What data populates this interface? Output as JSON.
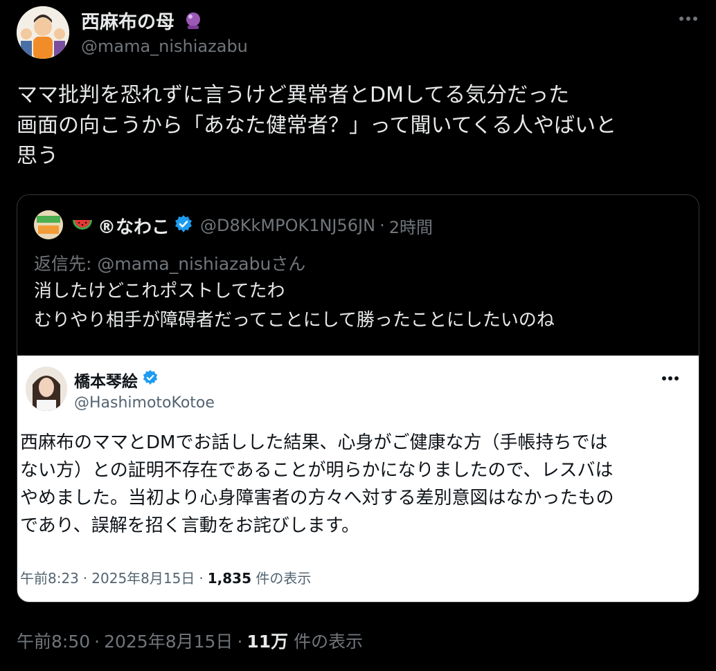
{
  "post": {
    "author_name": "西麻布の母",
    "author_badge_icon": "crystal-ball-icon",
    "author_handle": "@mama_nishiazabu",
    "text_lines": [
      "ママ批判を恐れずに言うけど異常者とDMしてる気分だった",
      "画面の向こうから「あなた健常者？」って聞いてくる人やばいと",
      "思う"
    ],
    "time": "午前8:50",
    "dot": "·",
    "date": "2025年8月15日",
    "views_count": "11万",
    "views_label": "件の表示"
  },
  "quote": {
    "emoji_icon": "watermelon-icon",
    "name": "®なわこ",
    "handle": "@D8KkMPOK1NJ56JN",
    "dot": "·",
    "time_ago": "2時間",
    "reply_to": "返信先: @mama_nishiazabuさん",
    "text_lines": [
      "消したけどこれポストしてたわ",
      "むりやり相手が障碍者だってことにして勝ったことにしたいのね"
    ]
  },
  "embedded": {
    "name": "橋本琴絵",
    "handle": "@HashimotoKotoe",
    "text_lines": [
      "西麻布のママとDMでお話しした結果、心身がご健康な方（手帳持ちでは",
      "ない方）との証明不存在であることが明らかになりましたので、レスバは",
      "やめました。当初より心身障害者の方々へ対する差別意図はなかったもの",
      "であり、誤解を招く言動をお詫びします。"
    ],
    "time": "午前8:23",
    "dot": "·",
    "date": "2025年8月15日",
    "views_count": "1,835",
    "views_label": "件の表示"
  },
  "colors": {
    "background": "#000000",
    "text": "#e7e9ea",
    "muted": "#71767b",
    "verified": "#1d9bf0"
  }
}
